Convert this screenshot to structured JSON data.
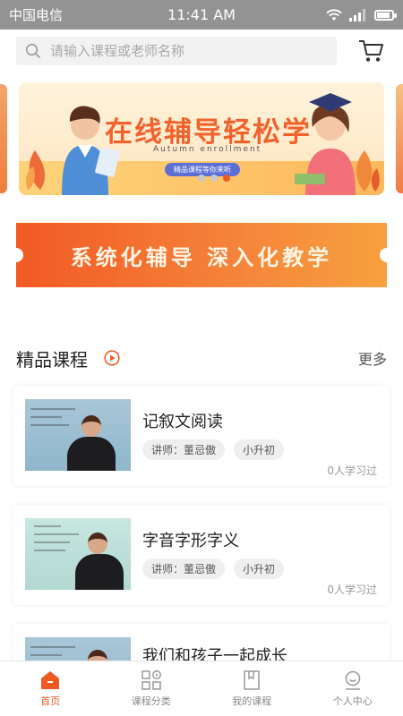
{
  "status": {
    "carrier": "中国电信",
    "time": "11:41 AM"
  },
  "search": {
    "placeholder": "请输入课程或老师名称"
  },
  "banner": {
    "title": "在线辅导轻松学",
    "subtitle": "Autumn enrollment",
    "pill": "精品课程等你来听",
    "dots_count": 3,
    "active_dot": 3
  },
  "promo": {
    "text": "系统化辅导  深入化教学"
  },
  "section": {
    "title": "精品课程",
    "more": "更多"
  },
  "courses": [
    {
      "title": "记叙文阅读",
      "teacher": "讲师：董忌傲",
      "level": "小升初",
      "learned": "0人学习过"
    },
    {
      "title": "字音字形字义",
      "teacher": "讲师：董忌傲",
      "level": "小升初",
      "learned": "0人学习过"
    },
    {
      "title": "我们和孩子一起成长",
      "teacher": "",
      "level": "",
      "learned": ""
    }
  ],
  "tabs": [
    {
      "label": "首页",
      "active": true
    },
    {
      "label": "课程分类",
      "active": false
    },
    {
      "label": "我的课程",
      "active": false
    },
    {
      "label": "个人中心",
      "active": false
    }
  ],
  "colors": {
    "accent": "#ef5a24",
    "status_bar": "#939393"
  }
}
